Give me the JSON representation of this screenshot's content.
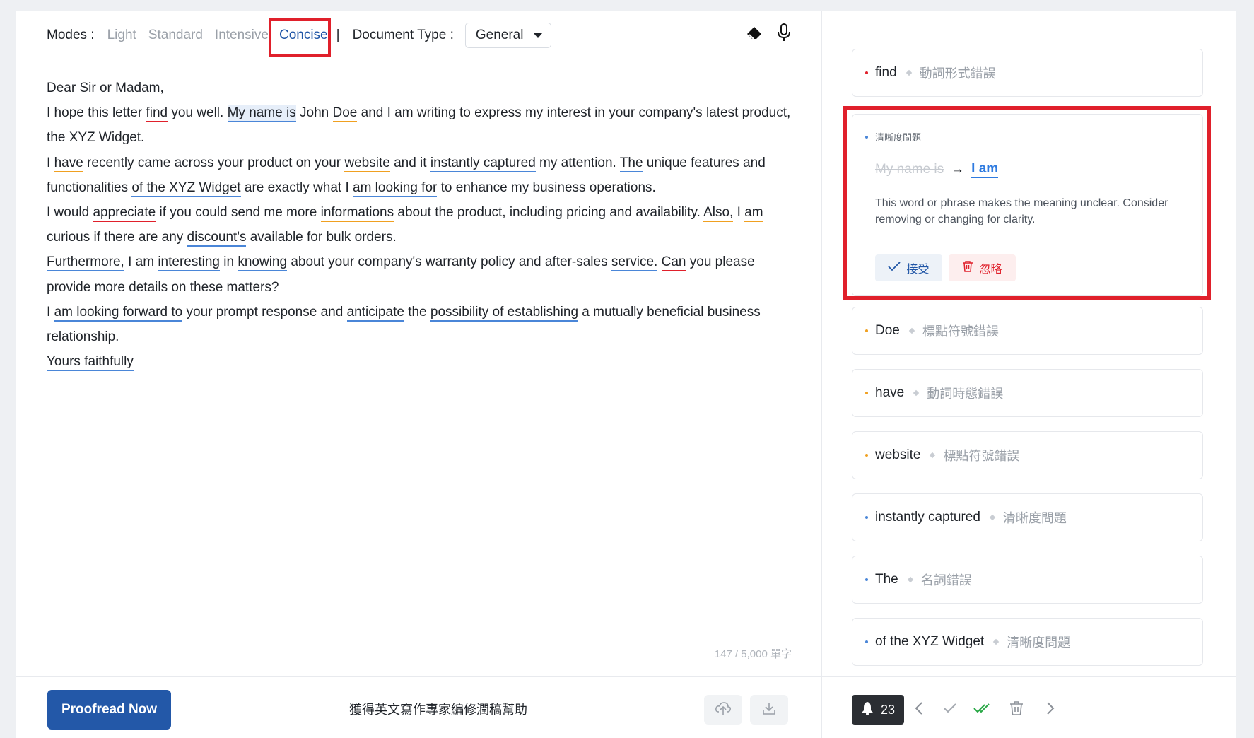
{
  "toolbar": {
    "modes_label": "Modes :",
    "modes": [
      "Light",
      "Standard",
      "Intensive",
      "Concise"
    ],
    "active_mode": "Concise",
    "pipe": "|",
    "doc_type_label": "Document Type :",
    "doc_type_value": "General"
  },
  "editor": {
    "greeting": "Dear Sir or Madam,",
    "p1": [
      "I hope this letter ",
      "find",
      " you well. ",
      "My name is",
      " John ",
      "Doe",
      " and I am writing to express my interest in your company's latest product, the XYZ Widget."
    ],
    "p2": [
      "I ",
      "have",
      " recently came across your product on your ",
      "website",
      " and it ",
      "instantly captured",
      " my attention. ",
      "The",
      " unique features and functionalities ",
      "of the XYZ Widget",
      " are exactly what I ",
      "am looking for",
      " to enhance my business operations."
    ],
    "p3": [
      "I would ",
      "appreciate",
      " if you could send me more ",
      "informations",
      " about the product, including pricing and availability. ",
      "Also,",
      " I ",
      "am",
      " curious if there are any ",
      "discount's",
      " available for bulk orders."
    ],
    "p4": [
      "Furthermore,",
      " I am ",
      "interesting",
      " in ",
      "knowing",
      " about your company's warranty policy and after-sales ",
      "service.",
      " ",
      "Can",
      " you please provide more details on these matters?"
    ],
    "p5": [
      "I ",
      "am looking forward to",
      " your prompt response and ",
      "anticipate",
      " the ",
      "possibility of establishing",
      " a mutually beneficial business relationship."
    ],
    "closing": "Yours faithfully",
    "word_count": "147 / 5,000 單字"
  },
  "bottom": {
    "proofread_label": "Proofread Now",
    "promo_text": "獲得英文寫作專家編修潤稿幫助",
    "notification_count": "23"
  },
  "panel": {
    "cards": [
      {
        "word": "find",
        "category": "動詞形式錯誤",
        "color": "red"
      },
      {
        "word": "Doe",
        "category": "標點符號錯誤",
        "color": "orange"
      },
      {
        "word": "have",
        "category": "動詞時態錯誤",
        "color": "orange"
      },
      {
        "word": "website",
        "category": "標點符號錯誤",
        "color": "orange"
      },
      {
        "word": "instantly captured",
        "category": "清晰度問題",
        "color": "blue"
      },
      {
        "word": "The",
        "category": "名詞錯誤",
        "color": "blue"
      },
      {
        "word": "of the XYZ Widget",
        "category": "清晰度問題",
        "color": "blue"
      }
    ],
    "expanded": {
      "category": "清晰度問題",
      "original": "My name is",
      "arrow": "→",
      "replacement": "I am",
      "message": "This word or phrase makes the meaning unclear. Consider removing or changing for clarity.",
      "accept_label": "接受",
      "ignore_label": "忽略"
    }
  },
  "colors": {
    "accent": "#1f55a6",
    "error": "#e0202b",
    "warning": "#f0a020",
    "clarity": "#4a86d8"
  }
}
